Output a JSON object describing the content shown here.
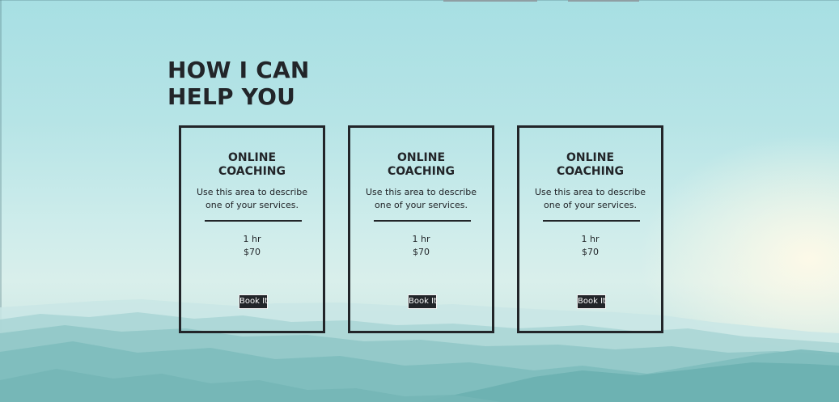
{
  "heading": "HOW I CAN HELP YOU",
  "colors": {
    "text": "#222529",
    "button_bg": "#222529",
    "button_text": "#ffffff",
    "sky": "#a7dfe3"
  },
  "services": [
    {
      "title": "ONLINE COACHING",
      "description": "Use this area to describe one of your services.",
      "duration": "1 hr",
      "price": "$70",
      "button_label": "Book It"
    },
    {
      "title": "ONLINE COACHING",
      "description": "Use this area to describe one of your services.",
      "duration": "1 hr",
      "price": "$70",
      "button_label": "Book It"
    },
    {
      "title": "ONLINE COACHING",
      "description": "Use this area to describe one of your services.",
      "duration": "1 hr",
      "price": "$70",
      "button_label": "Book It"
    }
  ]
}
